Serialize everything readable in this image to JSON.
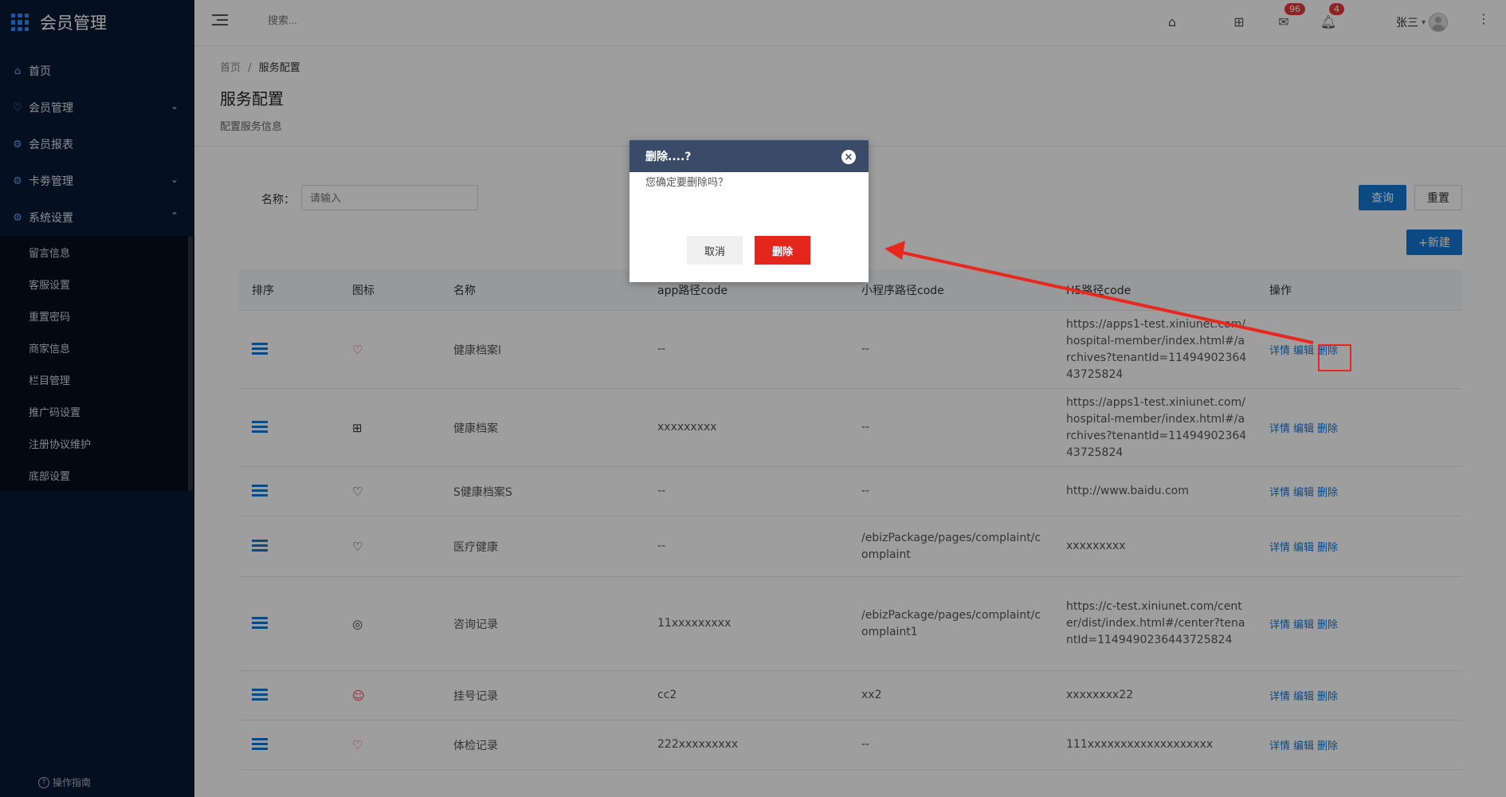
{
  "app": {
    "title": "会员管理"
  },
  "sidebar": {
    "items": [
      {
        "label": "首页",
        "icon": "home-icon",
        "chevron": ""
      },
      {
        "label": "会员管理",
        "icon": "heart-icon",
        "chevron": "⌄"
      },
      {
        "label": "会员报表",
        "icon": "gear-icon",
        "chevron": ""
      },
      {
        "label": "卡劵管理",
        "icon": "gear-icon",
        "chevron": "⌄"
      },
      {
        "label": "系统设置",
        "icon": "gear-icon",
        "chevron": "⌃"
      }
    ],
    "submenu": [
      {
        "label": "留言信息"
      },
      {
        "label": "客服设置"
      },
      {
        "label": "重置密码"
      },
      {
        "label": "商家信息"
      },
      {
        "label": "栏目管理"
      },
      {
        "label": "推广码设置"
      },
      {
        "label": "注册协议维护"
      },
      {
        "label": "底部设置"
      }
    ],
    "guide": "操作指南"
  },
  "header": {
    "search_placeholder": "搜索...",
    "mail_badge": "96",
    "bell_badge": "4",
    "user": "张三"
  },
  "page": {
    "breadcrumb_home": "首页",
    "breadcrumb_sep": "/",
    "breadcrumb_current": "服务配置",
    "title": "服务配置",
    "desc": "配置服务信息"
  },
  "filter": {
    "label": "名称：",
    "placeholder": "请输入",
    "query": "查询",
    "reset": "重置",
    "new": "+新建"
  },
  "table": {
    "headers": [
      "排序",
      "图标",
      "名称",
      "app路径code",
      "小程序路径code",
      "H5路径code",
      "操作"
    ],
    "rows": [
      {
        "icon": "♡",
        "icon_name": "heart-outline-icon",
        "icon_color": "red",
        "name": "健康档案l",
        "app": "--",
        "mini": "--",
        "h5": "https://apps1-test.xiniunet.com/hospital-member/index.html#/archives?tenantId=1149490236443725824",
        "height": 98
      },
      {
        "icon": "⊞",
        "icon_name": "gift-icon",
        "icon_color": "dark",
        "name": "健康档案",
        "app": "xxxxxxxxx",
        "mini": "--",
        "h5": "https://apps1-test.xiniunet.com/hospital-member/index.html#/archives?tenantId=1149490236443725824",
        "height": 98
      },
      {
        "icon": "♡",
        "icon_name": "heart-outline-icon",
        "icon_color": "dark",
        "name": "S健康档案S",
        "app": "--",
        "mini": "--",
        "h5": "http://www.baidu.com",
        "height": 62
      },
      {
        "icon": "♡",
        "icon_name": "heart-outline-icon",
        "icon_color": "dark",
        "name": "医疗健康",
        "app": "--",
        "mini": "/ebizPackage/pages/complaint/complaint",
        "h5": "xxxxxxxxx",
        "height": 76
      },
      {
        "icon": "◎",
        "icon_name": "location-pin-icon",
        "icon_color": "dark",
        "name": "咨询记录",
        "app": "11xxxxxxxxx",
        "mini": "/ebizPackage/pages/complaint/complaint1",
        "h5": "https://c-test.xiniunet.com/center/dist/index.html#/center?tenantId=1149490236443725824",
        "height": 118
      },
      {
        "icon": "☺",
        "icon_name": "smile-icon",
        "icon_color": "red",
        "name": "挂号记录",
        "app": "cc2",
        "mini": "xx2",
        "h5": "xxxxxxxx22",
        "height": 62
      },
      {
        "icon": "♡",
        "icon_name": "heart-outline-icon",
        "icon_color": "red",
        "name": "体检记录",
        "app": "222xxxxxxxxx",
        "mini": "--",
        "h5": "111xxxxxxxxxxxxxxxxxxx",
        "height": 62
      }
    ],
    "ops": {
      "detail": "详情",
      "edit": "编辑",
      "delete": "删除"
    }
  },
  "modal": {
    "title": "删除....?",
    "close": "×",
    "message": "您确定要删除吗？",
    "cancel": "取消",
    "confirm": "删除"
  },
  "colors": {
    "sidebar": "#071a33",
    "primary": "#1677d2",
    "danger": "#e4261c",
    "modal_header": "#394b67",
    "annotation": "#e8281e"
  }
}
